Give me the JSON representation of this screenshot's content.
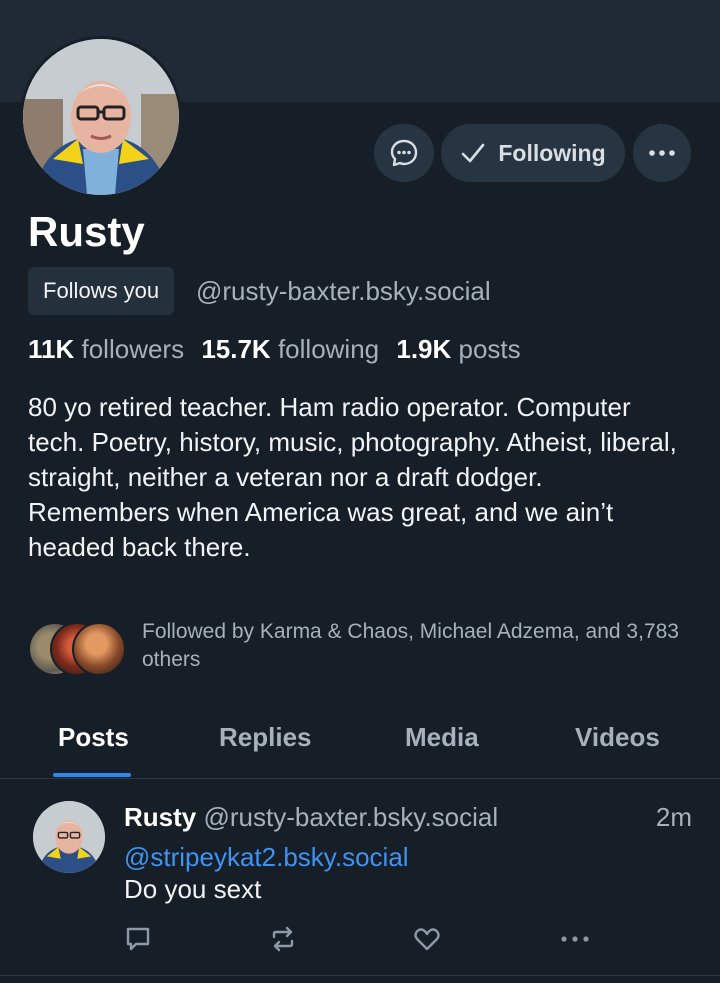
{
  "profile": {
    "display_name": "Rusty",
    "follows_you_label": "Follows you",
    "handle": "@rusty-baxter.bsky.social",
    "followers_count": "11K",
    "followers_label": "followers",
    "following_count": "15.7K",
    "following_label": "following",
    "posts_count": "1.9K",
    "posts_label": "posts",
    "bio": "80 yo retired teacher. Ham radio operator. Computer tech. Poetry, history, music, photography. Atheist, liberal, straight, neither a veteran nor a draft dodger. Remembers when America was great, and we ain’t headed back there.",
    "followed_by": "Followed by Karma & Chaos, Michael Adzema, and 3,783 others"
  },
  "actions": {
    "following_label": "Following",
    "chat_icon": "chat-bubble-icon",
    "more_icon": "ellipsis-icon"
  },
  "tabs": [
    {
      "label": "Posts",
      "active": true
    },
    {
      "label": "Replies",
      "active": false
    },
    {
      "label": "Media",
      "active": false
    },
    {
      "label": "Videos",
      "active": false
    }
  ],
  "post": {
    "author_name": "Rusty",
    "author_handle": "@rusty-baxter.bsky.social",
    "time": "2m",
    "mention": "@stripeykat2.bsky.social",
    "text": "Do you sext"
  },
  "colors": {
    "background": "#161e27",
    "accent": "#2a88f0",
    "muted_text": "#a6b1bc"
  }
}
